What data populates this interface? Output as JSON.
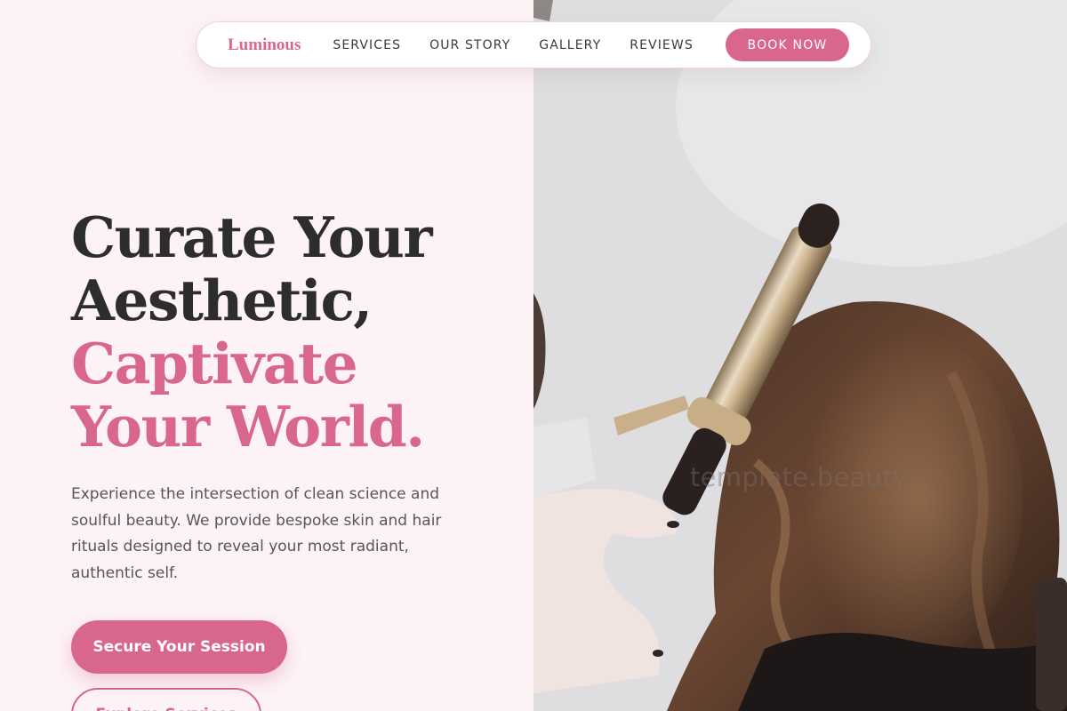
{
  "nav": {
    "logo": "Luminous",
    "links": [
      "SERVICES",
      "OUR STORY",
      "GALLERY",
      "REVIEWS"
    ],
    "cta_label": "BOOK NOW"
  },
  "hero": {
    "title_lines": [
      "Curate Your",
      "Aesthetic,"
    ],
    "accent_lines": [
      "Captivate",
      "Your World."
    ],
    "description": "Experience the intersection of clean science and soulful beauty. We provide bespoke skin and hair rituals designed to reveal your most radiant, authentic self.",
    "primary_cta": "Secure Your Session",
    "secondary_cta": "Explore Services"
  },
  "photo": {
    "watermark": "template.beauty",
    "subject": "stylist curling hair with curling iron"
  },
  "colors": {
    "accent": "#d9668d",
    "background": "#fdf2f4",
    "heading": "#2d2d2d",
    "body_text": "#555560"
  }
}
